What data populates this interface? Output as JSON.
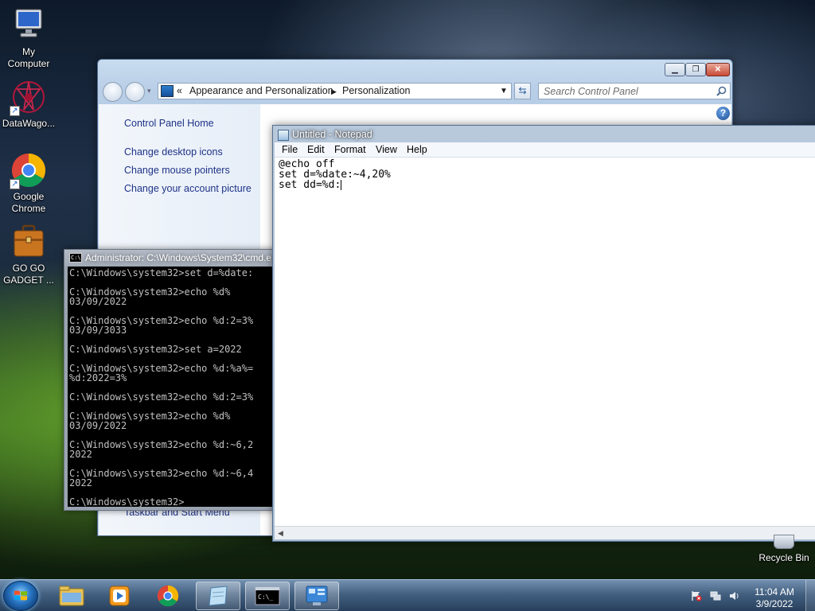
{
  "desktop": {
    "icons": [
      {
        "label": "My\nComputer",
        "icon": "computer-icon"
      },
      {
        "label": "DataWago...",
        "icon": "datawagon-icon"
      },
      {
        "label": "Google\nChrome",
        "icon": "chrome-icon"
      },
      {
        "label": "GO GO\nGADGET ...",
        "icon": "briefcase-icon"
      }
    ],
    "recycle_bin_label": "Recycle Bin"
  },
  "control_panel": {
    "breadcrumb_prefix": "«",
    "breadcrumb": [
      "Appearance and Personalization",
      "Personalization"
    ],
    "search_placeholder": "Search Control Panel",
    "links": [
      "Control Panel Home",
      "Change desktop icons",
      "Change mouse pointers",
      "Change your account picture",
      "Taskbar and Start Menu"
    ]
  },
  "cmd": {
    "title": "Administrator: C:\\Windows\\System32\\cmd.exe",
    "lines": [
      "C:\\Windows\\system32>set d=%date:",
      "",
      "C:\\Windows\\system32>echo %d%",
      "03/09/2022",
      "",
      "C:\\Windows\\system32>echo %d:2=3%",
      "03/09/3033",
      "",
      "C:\\Windows\\system32>set a=2022",
      "",
      "C:\\Windows\\system32>echo %d:%a%=",
      "%d:2022=3%",
      "",
      "C:\\Windows\\system32>echo %d:2=3%",
      "",
      "C:\\Windows\\system32>echo %d%",
      "03/09/2022",
      "",
      "C:\\Windows\\system32>echo %d:~6,2",
      "2022",
      "",
      "C:\\Windows\\system32>echo %d:~6,4",
      "2022",
      "",
      "C:\\Windows\\system32>"
    ]
  },
  "notepad": {
    "title": "Untitled - Notepad",
    "menu": [
      "File",
      "Edit",
      "Format",
      "View",
      "Help"
    ],
    "lines": [
      "@echo off",
      "set d=%date:~4,20%",
      "set dd=%d:"
    ]
  },
  "taskbar": {
    "apps": [
      "explorer-icon",
      "media-player-icon",
      "chrome-icon",
      "notepad-icon",
      "cmd-icon",
      "control-panel-icon"
    ],
    "clock_time": "11:04 AM",
    "clock_date": "3/9/2022"
  },
  "colors": {
    "link": "#1e3287",
    "console_bg": "#000000",
    "console_fg": "#c0c0c0"
  }
}
